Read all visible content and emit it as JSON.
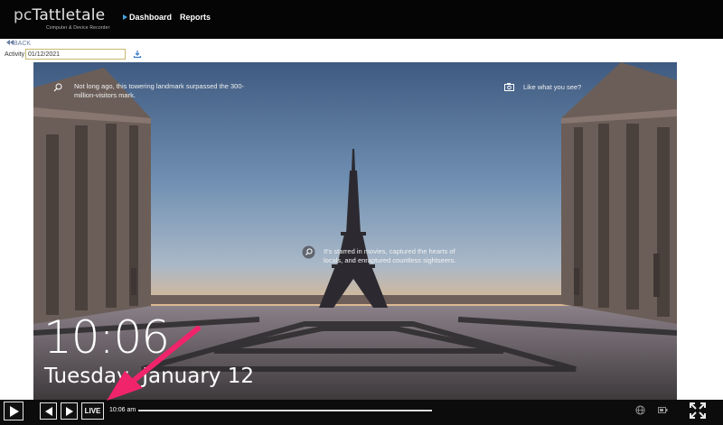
{
  "header": {
    "logo_prefix": "pc",
    "logo_main": "Tattletale",
    "logo_tagline": "Computer & Device Recorder",
    "nav": [
      {
        "label": "Dashboard",
        "active": true
      },
      {
        "label": "Reports",
        "active": false
      }
    ]
  },
  "toolbar": {
    "back_label": "BACK",
    "activity_label": "Activity on:",
    "activity_date": "01/12/2021",
    "download_icon": "download-icon"
  },
  "lockscreen": {
    "fact_text": "Not long ago, this towering landmark surpassed the 300-million-visitors mark.",
    "like_text": "Like what you see?",
    "caption_text": "It's starred in movies, captured the hearts of locals, and enraptured countless sightseers.",
    "clock": "10:06",
    "date": "Tuesday, January 12"
  },
  "player": {
    "live_label": "LIVE",
    "current_time": "10:06 am",
    "progress_fraction": 1.0,
    "icons": [
      "play-icon",
      "previous-icon",
      "next-icon",
      "globe-icon",
      "battery-icon",
      "fullscreen-icon"
    ]
  },
  "colors": {
    "header_bg": "#050505",
    "nav_arrow": "#4aa3e0",
    "annotation_arrow": "#f0246a",
    "back_link": "#6a7fa3"
  }
}
